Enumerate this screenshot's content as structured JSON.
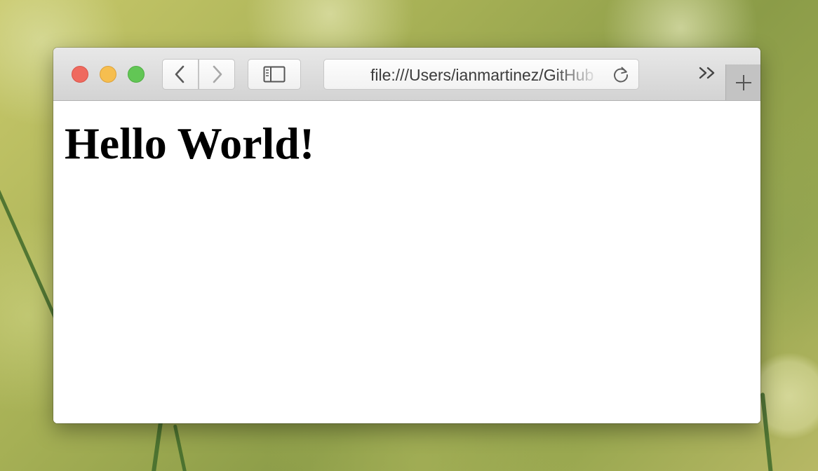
{
  "browser": {
    "address_bar": {
      "url": "file:///Users/ianmartinez/GitHub"
    },
    "icons": {
      "back": "chevron-left-icon",
      "forward": "chevron-right-icon",
      "sidebar": "sidebar-icon",
      "reload": "reload-icon",
      "overflow": "double-chevron-right-icon",
      "new_tab": "plus-icon"
    },
    "colors": {
      "close": "#ef6a5f",
      "minimize": "#f6be4f",
      "zoom": "#62c655"
    }
  },
  "page": {
    "heading": "Hello World!"
  }
}
